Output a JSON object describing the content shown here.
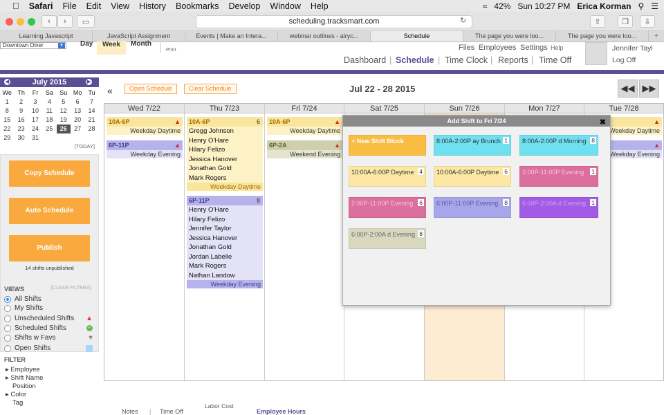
{
  "menubar": {
    "app": "Safari",
    "items": [
      "File",
      "Edit",
      "View",
      "History",
      "Bookmarks",
      "Develop",
      "Window",
      "Help"
    ],
    "battery": "42%",
    "clock": "Sun 10:27 PM",
    "user": "Erica Korman"
  },
  "browser": {
    "url": "scheduling.tracksmart.com",
    "tabs": [
      "Learning Javascript",
      "JavaScript Assignment",
      "Events | Make an Intera...",
      "webinar outlines - airyc...",
      "Schedule",
      "The page you were loo...",
      "The page you were loo..."
    ],
    "active_tab": 4
  },
  "apphead": {
    "location": "Downtown Diner",
    "view_day": "Day",
    "view_week": "Week",
    "view_month": "Month",
    "print": "Print",
    "links_top": [
      "Files",
      "Employees",
      "Settings",
      "Help"
    ],
    "nav": [
      "Dashboard",
      "Schedule",
      "Time Clock",
      "Reports",
      "Time Off"
    ],
    "user_name": "Jennifer Tayl",
    "logoff": "Log Off"
  },
  "toolbar": {
    "collapse": "«",
    "open_schedule": "Open Schedule",
    "clear_schedule": "Clear Schedule",
    "date_range": "Jul 22 - 28 2015"
  },
  "calendar": {
    "month": "July 2015",
    "dow": [
      "We",
      "Th",
      "Fr",
      "Sa",
      "Su",
      "Mo",
      "Tu"
    ],
    "weeks": [
      [
        "1",
        "2",
        "3",
        "4",
        "5",
        "6",
        "7"
      ],
      [
        "8",
        "9",
        "10",
        "11",
        "12",
        "13",
        "14"
      ],
      [
        "15",
        "16",
        "17",
        "18",
        "19",
        "20",
        "21"
      ],
      [
        "22",
        "23",
        "24",
        "25",
        "26",
        "27",
        "28"
      ],
      [
        "29",
        "30",
        "31",
        "",
        "",
        "",
        ""
      ]
    ],
    "today_label": "[TODAY]"
  },
  "sidebar": {
    "copy": "Copy Schedule",
    "auto": "Auto Schedule",
    "publish": "Publish",
    "unpublished": "14 shifts unpublished",
    "views_title": "VIEWS",
    "clear_filters": "[CLEAR FILTERS]",
    "views": [
      "All Shifts",
      "My Shifts",
      "Unscheduled Shifts",
      "Scheduled Shifts",
      "Shifts w Favs",
      "Open Shifts"
    ],
    "filter_title": "FILTER",
    "filters": [
      "Employee",
      "Shift Name",
      "Position",
      "Color",
      "Tag"
    ]
  },
  "days": [
    "Wed 7/22",
    "Thu 7/23",
    "Fri 7/24",
    "Sat 7/25",
    "Sun 7/26",
    "Mon 7/27",
    "Tue 7/28"
  ],
  "shifts": {
    "wed": [
      {
        "time": "10A-6P",
        "label": "Weekday Daytime"
      },
      {
        "time": "6P-11P",
        "label": "Weekday Evening"
      }
    ],
    "thu_a": {
      "time": "10A-6P",
      "count": "6",
      "names": [
        "Gregg Johnson",
        "Henry O'Hare",
        "Hilary Felizo",
        "Jessica Hanover",
        "Jonathan Gold",
        "Mark Rogers"
      ],
      "label": "Weekday Daytime"
    },
    "thu_b": {
      "time": "6P-11P",
      "count": "8",
      "names": [
        "Henry O'Hare",
        "Hilary Felizo",
        "Jennifer Taylor",
        "Jessica Hanover",
        "Jonathan Gold",
        "Jordan Labelle",
        "Mark Rogers",
        "Nathan Landow"
      ],
      "label": "Weekday Evening"
    },
    "fri": [
      {
        "time": "10A-6P",
        "label": "Weekday Daytime"
      },
      {
        "time": "6P-2A",
        "label": "Weekend Evening"
      }
    ],
    "tue": [
      {
        "label": "Weekday Daytime"
      },
      {
        "label": "Weekday Evening"
      }
    ]
  },
  "popup": {
    "title": "Add Shift to Fri 7/24",
    "new_block": "+ New Shift Block",
    "blocks": [
      {
        "text": "8:00A-2:00P ay Brunch",
        "count": "1",
        "color": "#6ee0f0"
      },
      {
        "text": "8:00A-2:00P d Morning",
        "count": "8",
        "color": "#6ee0f0"
      },
      {
        "text": "10:00A-6:00P Daytime",
        "count": "4",
        "color": "#fde7a5"
      },
      {
        "text": "10:00A-6:00P Daytime",
        "count": "6",
        "color": "#fde7a5"
      },
      {
        "text": "2:00P-11:00P Evening",
        "count": "1",
        "color": "#dc6f9e"
      },
      {
        "text": "2:00P-11:00P Evening",
        "count": "6",
        "color": "#dc6f9e"
      },
      {
        "text": "6:00P-11:00P Evening",
        "count": "8",
        "color": "#a8a6ea"
      },
      {
        "text": "6:00P-2:00A d Evening",
        "count": "1",
        "color": "#a35be6"
      },
      {
        "text": "6:00P-2:00A d Evening",
        "count": "8",
        "color": "#d8d8bf"
      }
    ]
  },
  "footer": {
    "notes": "Notes",
    "time_off": "Time Off",
    "labor": "Labor Cost",
    "hours": "Employee Hours"
  }
}
